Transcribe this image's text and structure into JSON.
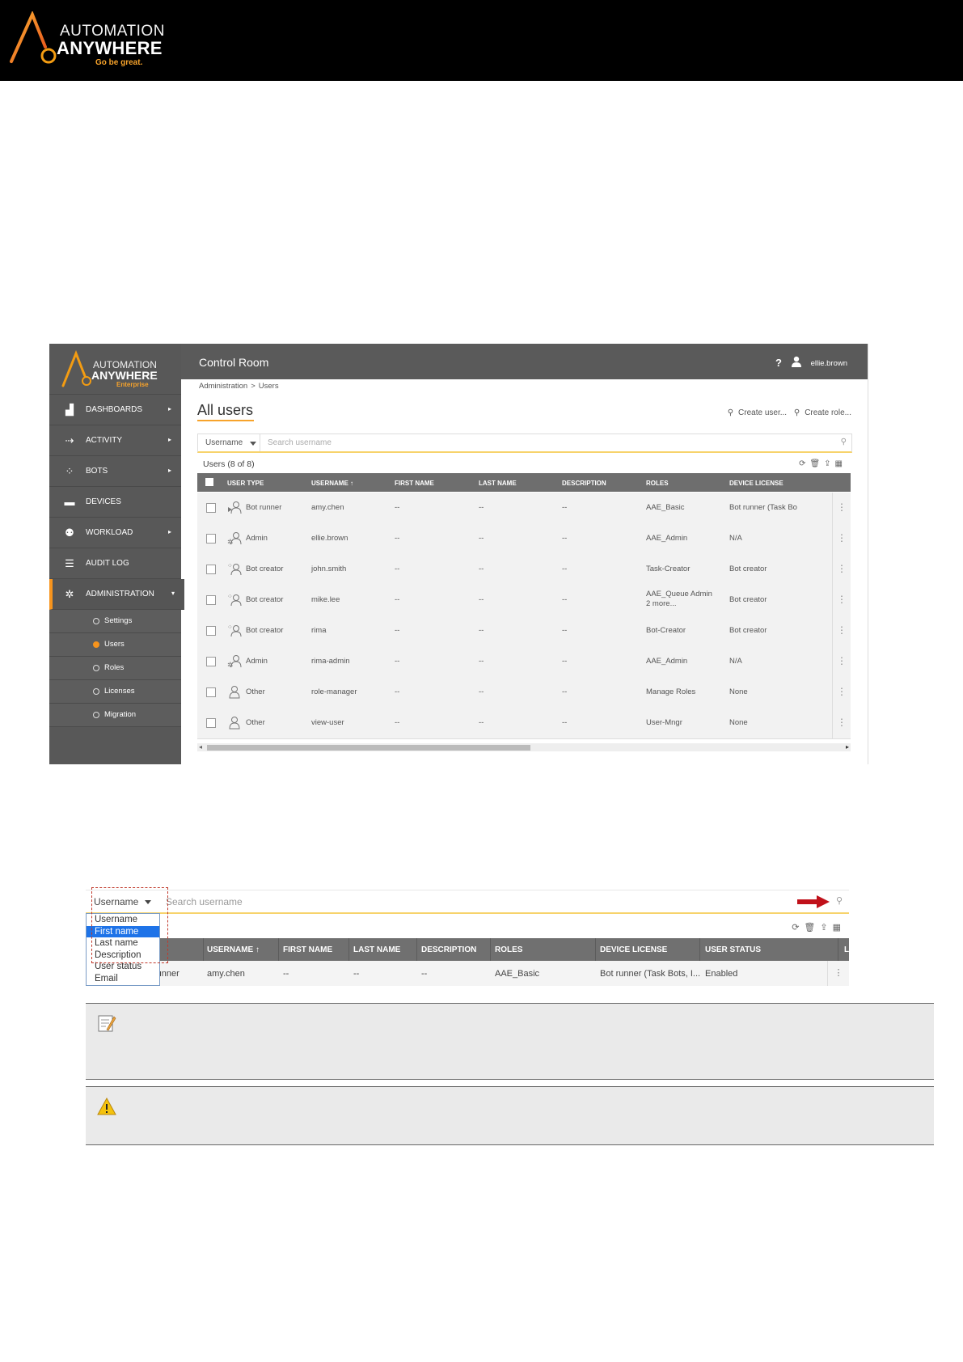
{
  "banner": {
    "logo_line1": "AUTOMATION",
    "logo_line2": "ANYWHERE",
    "tagline": "Go be great."
  },
  "app": {
    "logo_line1": "AUTOMATION",
    "logo_line2": "ANYWHERE",
    "logo_edition": "Enterprise",
    "title": "Control Room",
    "help": "?",
    "user": "ellie.brown",
    "breadcrumb": [
      "Administration",
      ">",
      "Users"
    ],
    "page_title": "All users",
    "create_user": "Create user...",
    "create_role": "Create role..."
  },
  "sidebar": {
    "items": [
      {
        "label": "DASHBOARDS",
        "icon": "dashboard-icon",
        "arrow": "▸"
      },
      {
        "label": "ACTIVITY",
        "icon": "activity-icon",
        "arrow": "▸"
      },
      {
        "label": "BOTS",
        "icon": "bots-icon",
        "arrow": "▸"
      },
      {
        "label": "DEVICES",
        "icon": "devices-icon",
        "arrow": ""
      },
      {
        "label": "WORKLOAD",
        "icon": "workload-icon",
        "arrow": "▸"
      },
      {
        "label": "AUDIT LOG",
        "icon": "audit-log-icon",
        "arrow": ""
      },
      {
        "label": "ADMINISTRATION",
        "icon": "gear-icon",
        "arrow": "▾"
      }
    ],
    "sub_items": [
      "Settings",
      "Users",
      "Roles",
      "Licenses",
      "Migration"
    ],
    "active_sub": "Users",
    "accent": "#f7941d"
  },
  "search": {
    "filter": "Username",
    "placeholder": "Search username"
  },
  "table": {
    "count": "Users (8 of 8)",
    "headers": [
      "USER TYPE",
      "USERNAME ↑",
      "FIRST NAME",
      "LAST NAME",
      "DESCRIPTION",
      "ROLES",
      "DEVICE LICENSE"
    ],
    "rows": [
      {
        "type": "Bot runner",
        "username": "amy.chen",
        "first": "--",
        "last": "--",
        "desc": "--",
        "roles": "AAE_Basic",
        "roles2": "",
        "license": "Bot runner (Task Bo"
      },
      {
        "type": "Admin",
        "username": "ellie.brown",
        "first": "--",
        "last": "--",
        "desc": "--",
        "roles": "AAE_Admin",
        "roles2": "",
        "license": "N/A"
      },
      {
        "type": "Bot creator",
        "username": "john.smith",
        "first": "--",
        "last": "--",
        "desc": "--",
        "roles": "Task-Creator",
        "roles2": "",
        "license": "Bot creator"
      },
      {
        "type": "Bot creator",
        "username": "mike.lee",
        "first": "--",
        "last": "--",
        "desc": "--",
        "roles": "AAE_Queue Admin",
        "roles2": "2 more...",
        "license": "Bot creator"
      },
      {
        "type": "Bot creator",
        "username": "rima",
        "first": "--",
        "last": "--",
        "desc": "--",
        "roles": "Bot-Creator",
        "roles2": "",
        "license": "Bot creator"
      },
      {
        "type": "Admin",
        "username": "rima-admin",
        "first": "--",
        "last": "--",
        "desc": "--",
        "roles": "AAE_Admin",
        "roles2": "",
        "license": "N/A"
      },
      {
        "type": "Other",
        "username": "role-manager",
        "first": "--",
        "last": "--",
        "desc": "--",
        "roles": "Manage Roles",
        "roles2": "",
        "license": "None"
      },
      {
        "type": "Other",
        "username": "view-user",
        "first": "--",
        "last": "--",
        "desc": "--",
        "roles": "User-Mngr",
        "roles2": "",
        "license": "None"
      }
    ]
  },
  "zoom": {
    "filter": "Username",
    "placeholder": "Search username",
    "options": [
      "Username",
      "First name",
      "Last name",
      "Description",
      "User status",
      "Email"
    ],
    "highlighted": "First name",
    "headers": [
      "E",
      "USERNAME ↑",
      "FIRST NAME",
      "LAST NAME",
      "DESCRIPTION",
      "ROLES",
      "DEVICE LICENSE",
      "USER STATUS",
      "L"
    ],
    "row": {
      "type": "runner",
      "username": "amy.chen",
      "first": "--",
      "last": "--",
      "desc": "--",
      "roles": "AAE_Basic",
      "license": "Bot runner (Task Bots, I...",
      "status": "Enabled"
    }
  },
  "notes": [
    {
      "icon": "note-icon"
    },
    {
      "icon": "warning-icon"
    }
  ]
}
